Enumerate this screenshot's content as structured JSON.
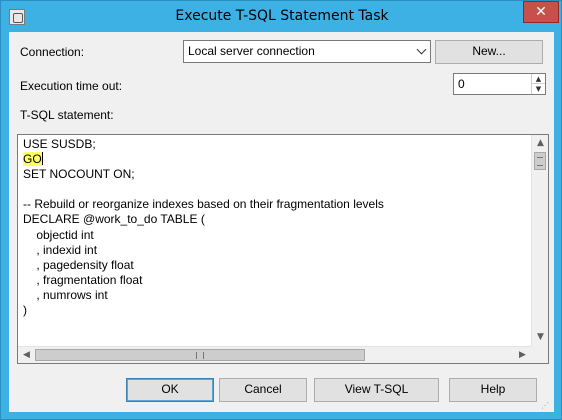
{
  "window": {
    "title": "Execute T-SQL Statement Task",
    "close_glyph": "✕"
  },
  "connection": {
    "label": "Connection:",
    "value": "Local server connection",
    "new_button_label": "New..."
  },
  "timeout": {
    "label": "Execution time out:",
    "value": "0"
  },
  "statement": {
    "label": "T-SQL statement:",
    "lines": [
      "USE SUSDB;",
      "GO",
      "SET NOCOUNT ON;",
      "",
      "-- Rebuild or reorganize indexes based on their fragmentation levels",
      "DECLARE @work_to_do TABLE (",
      "    objectid int",
      "    , indexid int",
      "    , pagedensity float",
      "    , fragmentation float",
      "    , numrows int",
      ")"
    ],
    "highlight_color": "#ffff66"
  },
  "buttons": {
    "ok": "OK",
    "cancel": "Cancel",
    "view_tsql": "View T-SQL",
    "help": "Help"
  },
  "icons": {
    "dropdown": "chevron-down-icon",
    "spin_up": "▲",
    "spin_down": "▼",
    "scroll_up": "▲",
    "scroll_down": "▼",
    "scroll_left": "◀",
    "scroll_right": "▶",
    "grip": "⋰"
  }
}
